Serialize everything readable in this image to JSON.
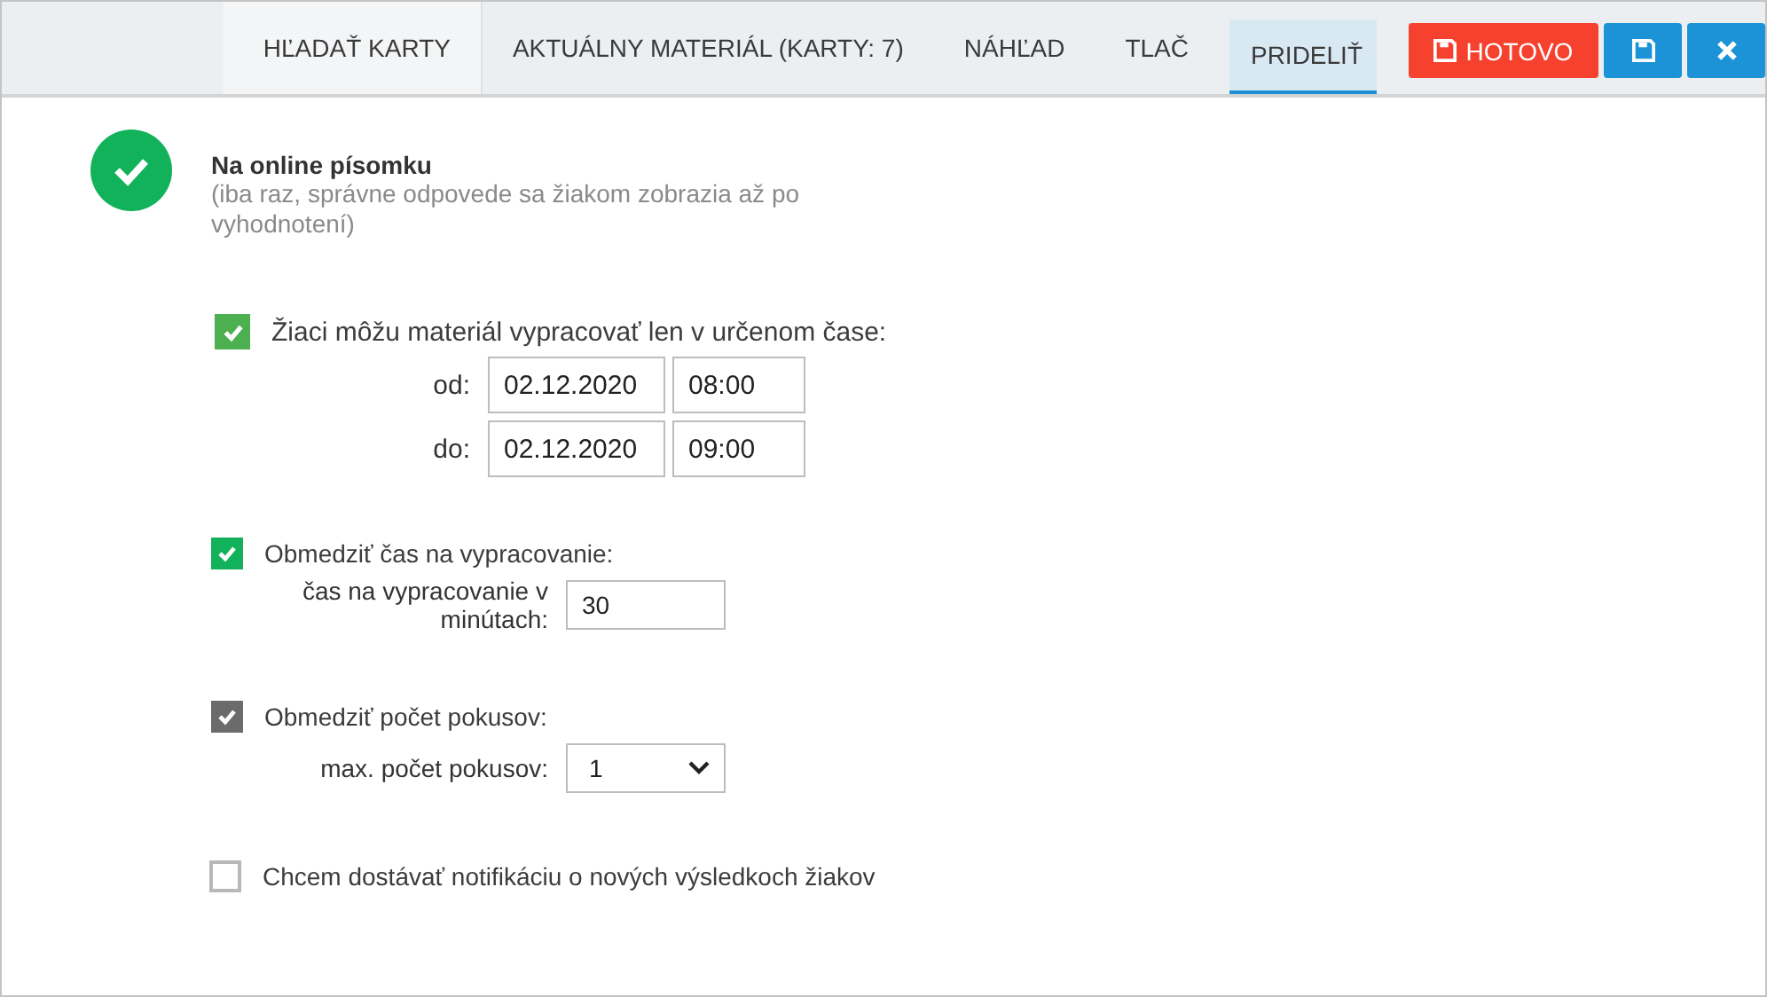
{
  "tabs": [
    {
      "label": "HĽADAŤ KARTY",
      "selected": false
    },
    {
      "label": "AKTUÁLNY MATERIÁL (KARTY: 7)",
      "selected": false
    },
    {
      "label": "NÁHĽAD",
      "selected": false
    },
    {
      "label": "TLAČ",
      "selected": false
    },
    {
      "label": "PRIDELIŤ",
      "selected": true
    }
  ],
  "actions": [
    {
      "kind": "done",
      "label": "HOTOVO"
    },
    {
      "kind": "save"
    },
    {
      "kind": "close"
    }
  ],
  "mode": {
    "title": "Na online písomku",
    "note": "(iba raz, správne odpovede sa žiakom zobrazia až po vyhodnotení)"
  },
  "time_window": {
    "checked": true,
    "label": "Žiaci môžu materiál vypracovať len v určenom čase:",
    "rows": [
      {
        "label": "od:",
        "date": "02.12.2020",
        "time": "08:00"
      },
      {
        "label": "do:",
        "date": "02.12.2020",
        "time": "09:00"
      }
    ]
  },
  "time_limit": {
    "checked": true,
    "disabled": false,
    "label": "Obmedziť čas na vypracovanie:",
    "field_label": "čas na vypracovanie v minútach:",
    "value": "30"
  },
  "attempts": {
    "checked": true,
    "disabled": true,
    "label": "Obmedziť počet pokusov:",
    "field_label": "max. počet pokusov:",
    "value": "1"
  },
  "notify": {
    "checked": false,
    "label": "Chcem dostávať notifikáciu o nových výsledkoch žiakov"
  }
}
